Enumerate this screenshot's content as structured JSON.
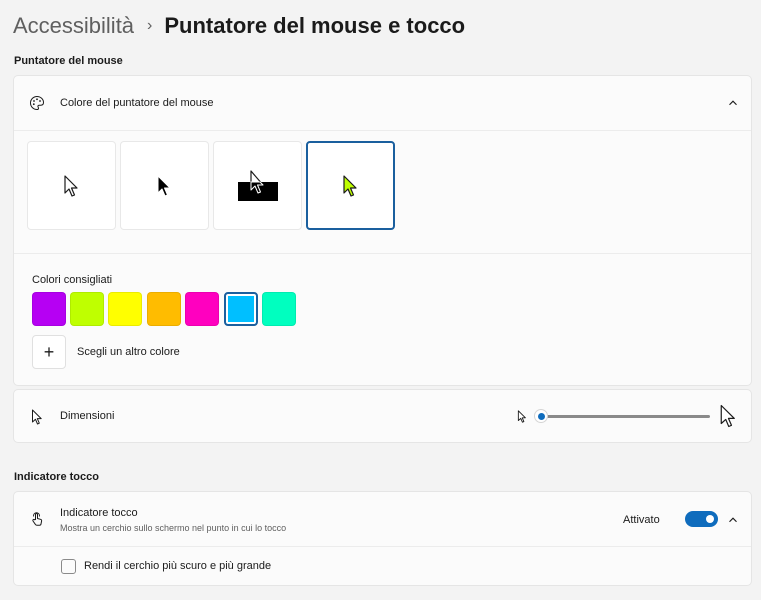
{
  "breadcrumb": {
    "parent": "Accessibilità",
    "separator": "›",
    "current": "Puntatore del mouse e tocco"
  },
  "mouse_section": {
    "title": "Puntatore del mouse",
    "color_row": {
      "label": "Colore del puntatore del mouse",
      "icon": "palette-icon",
      "expanded": true
    },
    "pointer_styles": [
      "white",
      "black",
      "inverted",
      "custom"
    ],
    "selected_style": "custom",
    "recommended": {
      "label": "Colori consigliati",
      "swatches": [
        "#b600f3",
        "#bfff00",
        "#ffff00",
        "#ffbc00",
        "#ff00bf",
        "#00bfff",
        "#00ffbf"
      ],
      "selected_swatch": "#00bfff"
    },
    "other_color_label": "Scegli un altro colore",
    "size_row": {
      "label": "Dimensioni",
      "icon": "pointer-icon",
      "value": 1,
      "min": 1,
      "max": 15
    }
  },
  "touch_section": {
    "title": "Indicatore tocco",
    "indicator_row": {
      "label": "Indicatore tocco",
      "sublabel": "Mostra un cerchio sullo schermo nel punto in cui lo tocco",
      "status": "Attivato",
      "on": true
    },
    "checkbox": {
      "label": "Rendi il cerchio più scuro e più grande",
      "checked": false
    }
  },
  "colors": {
    "accent": "#0f6cbd",
    "custom_pointer": "#bfff00"
  }
}
